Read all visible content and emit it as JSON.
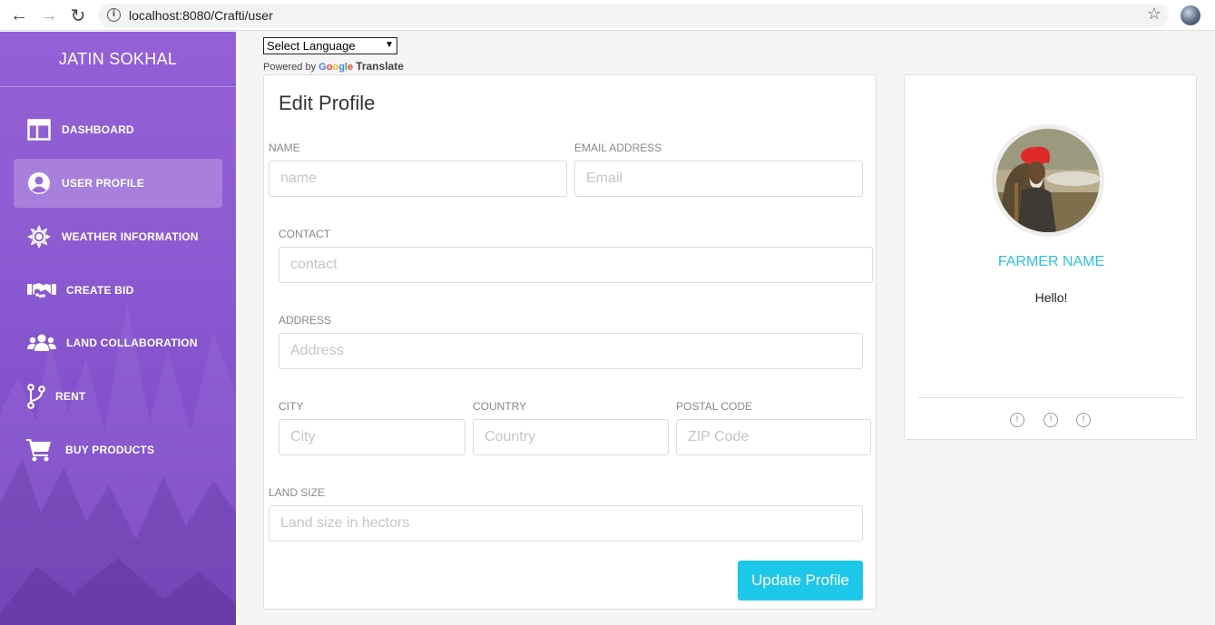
{
  "browser": {
    "url": "localhost:8080/Crafti/user",
    "back_icon": "←",
    "forward_icon": "→",
    "reload_icon": "↻",
    "info_icon": "i",
    "star_icon": "☆"
  },
  "sidebar": {
    "brand": "JATIN SOKHAL",
    "items": [
      {
        "label": "DASHBOARD",
        "icon": "dashboard-icon"
      },
      {
        "label": "USER PROFILE",
        "icon": "user-circle-icon"
      },
      {
        "label": "WEATHER INFORMATION",
        "icon": "sun-icon"
      },
      {
        "label": "CREATE BID",
        "icon": "handshake-icon"
      },
      {
        "label": "LAND COLLABORATION",
        "icon": "users-icon"
      },
      {
        "label": "RENT",
        "icon": "code-branch-icon"
      },
      {
        "label": "BUY PRODUCTS",
        "icon": "shopping-cart-icon"
      }
    ],
    "active_index": 1
  },
  "translate": {
    "select_value": "Select Language",
    "powered_by": "Powered by",
    "google": "Google",
    "translate": "Translate"
  },
  "edit_profile": {
    "title": "Edit Profile",
    "fields": {
      "name": {
        "label": "NAME",
        "placeholder": "name"
      },
      "email": {
        "label": "EMAIL ADDRESS",
        "placeholder": "Email"
      },
      "contact": {
        "label": "CONTACT",
        "placeholder": "contact"
      },
      "address": {
        "label": "ADDRESS",
        "placeholder": "Address"
      },
      "city": {
        "label": "CITY",
        "placeholder": "City"
      },
      "country": {
        "label": "COUNTRY",
        "placeholder": "Country"
      },
      "postal": {
        "label": "POSTAL CODE",
        "placeholder": "ZIP Code"
      },
      "land": {
        "label": "LAND SIZE",
        "placeholder": "Land size in hectors"
      }
    },
    "submit_label": "Update Profile"
  },
  "profile_card": {
    "name": "FARMER NAME",
    "greeting": "Hello!",
    "social_icon_glyph": "!"
  },
  "colors": {
    "sidebar_top": "#9460d6",
    "sidebar_bottom": "#7a44c4",
    "accent": "#1dc7ea",
    "name_color": "#32bfe0"
  }
}
